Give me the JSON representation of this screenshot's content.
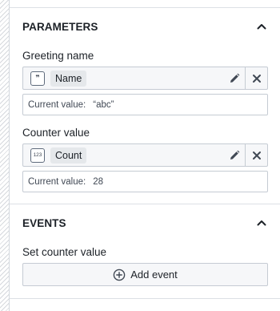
{
  "parameters": {
    "title": "PARAMETERS",
    "items": [
      {
        "label": "Greeting name",
        "type_icon": "quote-icon",
        "type_glyph": "❞",
        "tag": "Name",
        "value_label": "Current value:",
        "value": "“abc”"
      },
      {
        "label": "Counter value",
        "type_icon": "number-icon",
        "type_glyph": "123",
        "tag": "Count",
        "value_label": "Current value:",
        "value": "28"
      }
    ]
  },
  "events": {
    "title": "EVENTS",
    "items": [
      {
        "label": "Set counter value",
        "button_label": "Add event"
      }
    ]
  },
  "colors": {
    "text": "#1c2127",
    "border": "#c5cbd3",
    "row_bg": "#f6f7f9",
    "tag_bg": "#e5e8eb"
  }
}
